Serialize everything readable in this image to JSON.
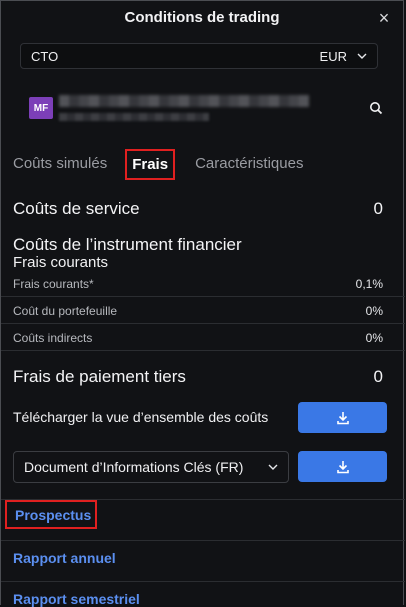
{
  "dialog": {
    "title": "Conditions de trading",
    "close_icon": "×"
  },
  "account": {
    "type": "CTO",
    "currency": "EUR"
  },
  "instrument": {
    "badge": "MF"
  },
  "tabs": [
    {
      "label": "Coûts simulés"
    },
    {
      "label": "Frais"
    },
    {
      "label": "Caractéristiques"
    }
  ],
  "fees": {
    "service_costs": {
      "label": "Coûts de service",
      "value": "0"
    },
    "instrument_costs": {
      "label": "Coûts de l’instrument financier"
    },
    "ongoing": {
      "label": "Frais courants",
      "rows": [
        {
          "label": "Frais courants*",
          "value": "0,1%"
        },
        {
          "label": "Coût du portefeuille",
          "value": "0%"
        },
        {
          "label": "Coûts indirects",
          "value": "0%"
        }
      ]
    },
    "third_party": {
      "label": "Frais de paiement tiers",
      "value": "0"
    }
  },
  "download": {
    "label": "Télécharger la vue d’ensemble des coûts"
  },
  "document_select": {
    "value": "Document d’Informations Clés (FR)"
  },
  "links": {
    "prospectus": "Prospectus",
    "annual_report": "Rapport annuel",
    "semi_annual_report": "Rapport semestriel"
  },
  "colors": {
    "accent": "#3a78e6",
    "link": "#5b8ff0",
    "highlight": "#e02020",
    "badge": "#7c3fb8"
  }
}
